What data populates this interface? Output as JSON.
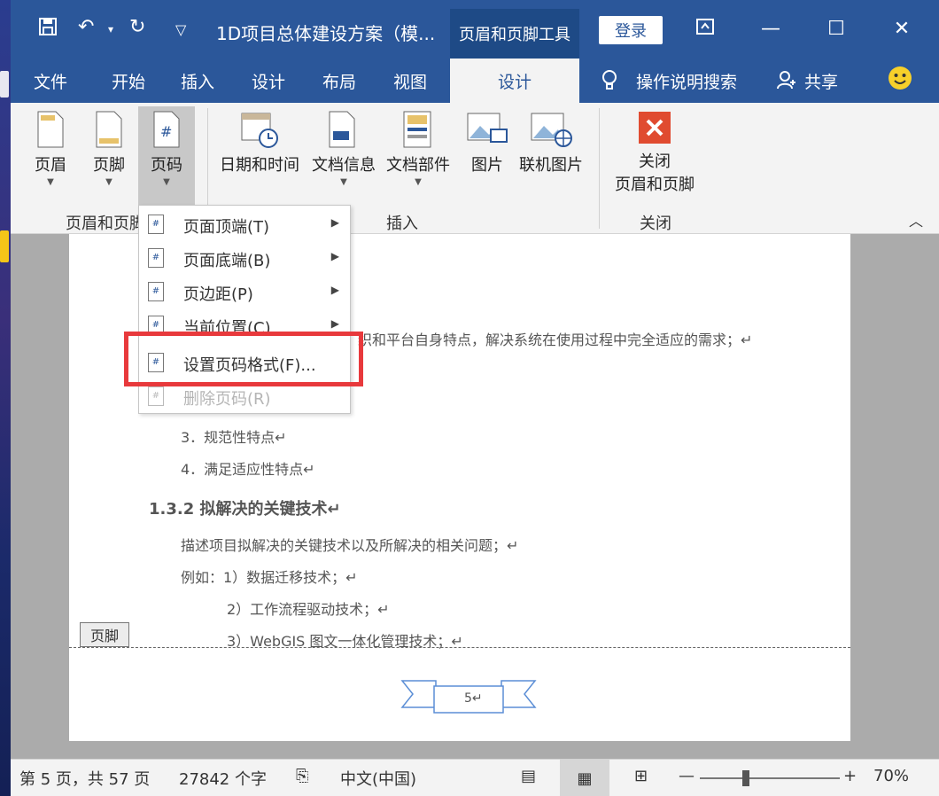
{
  "title_bar": {
    "document_title": "1D项目总体建设方案（模...",
    "contextual_tools": "页眉和页脚工具",
    "login_label": "登录"
  },
  "tabs": [
    "文件",
    "开始",
    "插入",
    "设计",
    "布局",
    "视图"
  ],
  "active_tab": "设计",
  "tell_me": "操作说明搜索",
  "share": "共享",
  "ribbon": {
    "group1": {
      "buttons": [
        "页眉",
        "页脚",
        "页码"
      ],
      "label": "页眉和页脚"
    },
    "group2": {
      "buttons": [
        "日期和时间",
        "文档信息",
        "文档部件",
        "图片",
        "联机图片"
      ],
      "label": "插入"
    },
    "group3": {
      "button_line1": "关闭",
      "button_line2": "页眉和页脚",
      "label": "关闭"
    }
  },
  "menu": {
    "items": [
      {
        "label": "页面顶端(T)",
        "submenu": true,
        "enabled": true
      },
      {
        "label": "页面底端(B)",
        "submenu": true,
        "enabled": true
      },
      {
        "label": "页边距(P)",
        "submenu": true,
        "enabled": true
      },
      {
        "label": "当前位置(C)",
        "submenu": true,
        "enabled": true
      },
      {
        "label": "设置页码格式(F)...",
        "submenu": false,
        "enabled": true
      },
      {
        "label": "删除页码(R)",
        "submenu": false,
        "enabled": false
      }
    ]
  },
  "document": {
    "line_partial": "织和平台自身特点，解决系统在使用过程中完全适应的需求；↵",
    "item3": "3．规范性特点↵",
    "item4": "4．满足适应性特点↵",
    "heading": "1.3.2  拟解决的关键技术↵",
    "para1": "描述项目拟解决的关键技术以及所解决的相关问题；↵",
    "para2": "例如：1）数据迁移技术；↵",
    "para3": "2）工作流程驱动技术；↵",
    "para4": "3）WebGIS 图文一体化管理技术；↵",
    "footer_tag": "页脚",
    "page_number": "5↵"
  },
  "status_bar": {
    "page": "第 5 页，共 57 页",
    "words": "27842 个字",
    "language": "中文(中国)",
    "zoom": "70%"
  },
  "colors": {
    "brand": "#2b579a",
    "highlight": "#e8393c"
  }
}
